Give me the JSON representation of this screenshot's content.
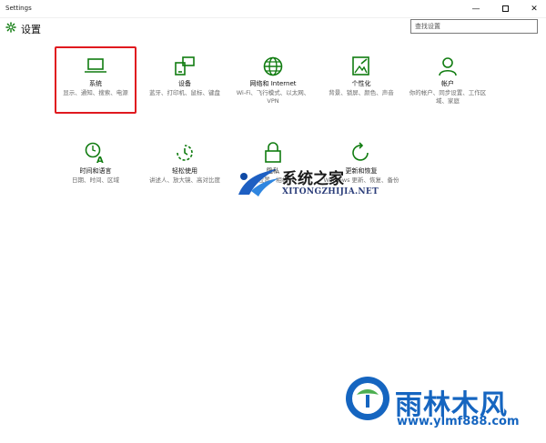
{
  "window": {
    "title": "Settings",
    "minimize": "—",
    "close": "✕"
  },
  "header": {
    "title": "设置",
    "search_placeholder": "查找设置"
  },
  "tiles": [
    {
      "title": "系统",
      "desc": "显示、通知、搜索、电源",
      "icon": "laptop-icon"
    },
    {
      "title": "设备",
      "desc": "蓝牙、打印机、鼠标、键盘",
      "icon": "devices-icon"
    },
    {
      "title": "网络和 Internet",
      "desc": "Wi-Fi、飞行模式、以太网、VPN",
      "icon": "globe-icon"
    },
    {
      "title": "个性化",
      "desc": "背景、锁屏、颜色、声音",
      "icon": "personalization-icon"
    },
    {
      "title": "帐户",
      "desc": "你的帐户、同步设置、工作区域、家庭",
      "icon": "person-icon"
    },
    {
      "title": "时间和语言",
      "desc": "日期、时间、区域",
      "icon": "time-language-icon"
    },
    {
      "title": "轻松使用",
      "desc": "讲述人、放大镜、高对比度",
      "icon": "ease-of-access-icon"
    },
    {
      "title": "隐私",
      "desc": "位置、相机",
      "icon": "lock-icon"
    },
    {
      "title": "更新和恢复",
      "desc": "Windows 更新、恢复、备份",
      "icon": "refresh-icon"
    }
  ],
  "watermark": {
    "center_cn": "系统之家",
    "center_en": "XITONGZHIJIA.NET",
    "brand": "雨林木风",
    "url": "www.ylmf888.com"
  },
  "colors": {
    "accent": "#107c10",
    "highlight": "#e0191f",
    "brand": "#1565c0"
  }
}
